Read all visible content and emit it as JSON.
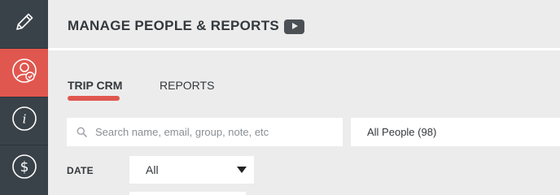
{
  "sidebar": {
    "items": [
      {
        "name": "edit",
        "icon": "pencil-icon",
        "active": false
      },
      {
        "name": "people",
        "icon": "user-check-icon",
        "active": true
      },
      {
        "name": "info",
        "icon": "info-icon",
        "active": false
      },
      {
        "name": "billing",
        "icon": "dollar-icon",
        "active": false
      }
    ]
  },
  "header": {
    "title": "MANAGE PEOPLE & REPORTS",
    "video_icon": "video-play-icon"
  },
  "tabs": [
    {
      "label": "TRIP CRM",
      "active": true
    },
    {
      "label": "REPORTS",
      "active": false
    }
  ],
  "search": {
    "placeholder": "Search name, email, group, note, etc",
    "value": ""
  },
  "people_filter": {
    "selected": "All People (98)"
  },
  "date_filter": {
    "label": "DATE",
    "selected": "All"
  },
  "colors": {
    "accent": "#e0574f",
    "sidebar": "#3a4249",
    "background": "#ececec",
    "text": "#33383d"
  }
}
